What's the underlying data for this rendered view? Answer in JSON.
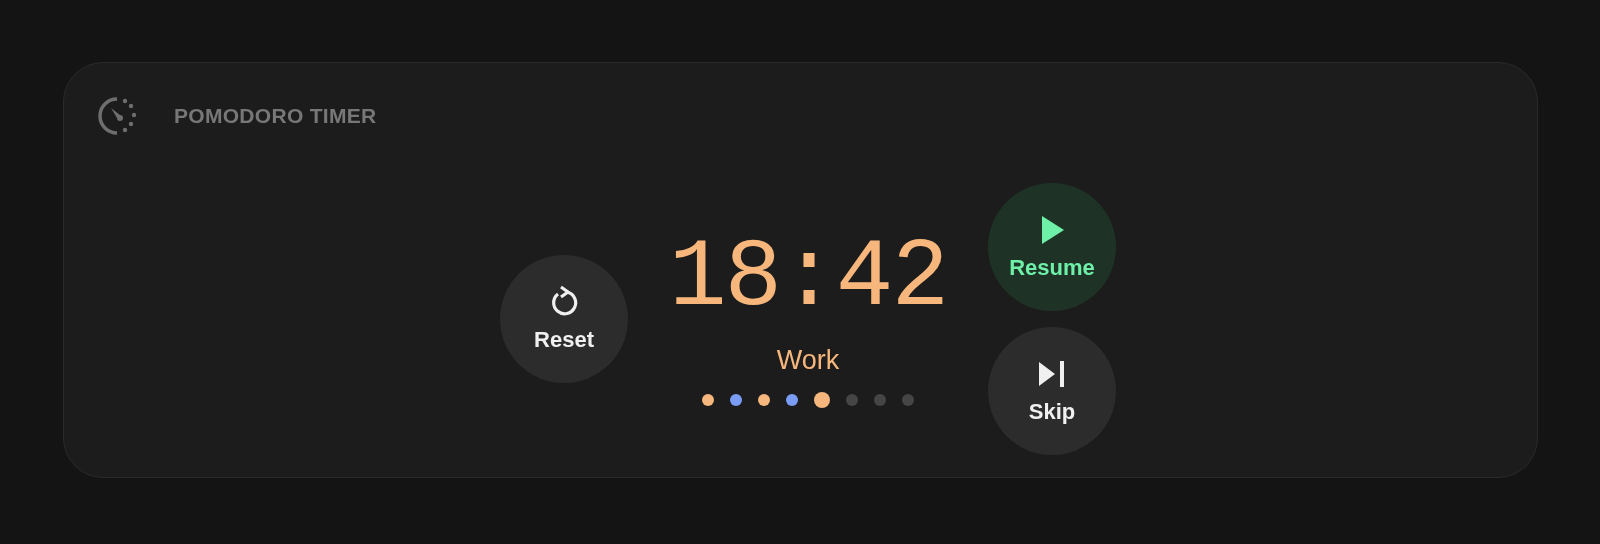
{
  "header": {
    "title": "POMODORO TIMER"
  },
  "timer": {
    "time": "18:42",
    "phase": "Work"
  },
  "sessions": [
    {
      "color": "#f5b77e",
      "selected": false
    },
    {
      "color": "#7b9cf5",
      "selected": false
    },
    {
      "color": "#f5b77e",
      "selected": false
    },
    {
      "color": "#7b9cf5",
      "selected": false
    },
    {
      "color": "#f5b77e",
      "selected": true
    },
    {
      "color": "#454545",
      "selected": false
    },
    {
      "color": "#454545",
      "selected": false
    },
    {
      "color": "#454545",
      "selected": false
    }
  ],
  "buttons": [
    {
      "kind": "reset",
      "label": "Reset",
      "primary": false
    },
    {
      "kind": "play",
      "label": "Resume",
      "primary": true
    },
    {
      "kind": "skip",
      "label": "Skip",
      "primary": false
    }
  ]
}
